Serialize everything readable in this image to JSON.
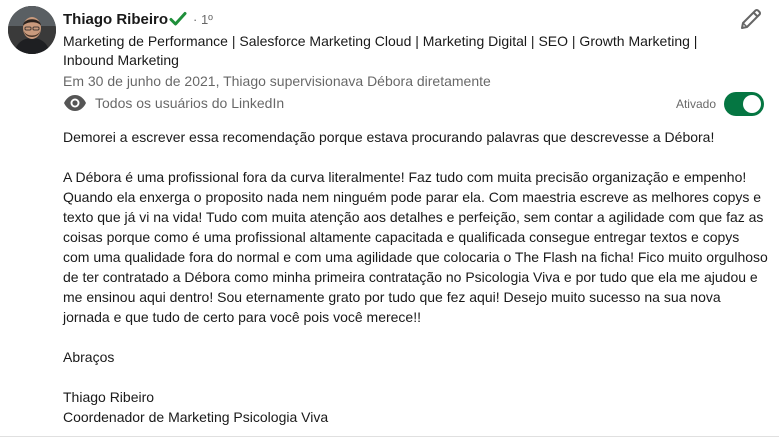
{
  "recommender": {
    "name": "Thiago Ribeiro",
    "degree": "· 1º",
    "headline": "Marketing de Performance | Salesforce Marketing Cloud | Marketing Digital | SEO | Growth Marketing | Inbound Marketing",
    "relationship": "Em 30 de junho de 2021, Thiago supervisionava Débora diretamente"
  },
  "visibility": {
    "text": "Todos os usuários do LinkedIn",
    "toggle_label": "Ativado",
    "toggle_on": true
  },
  "recommendation": {
    "intro": "Demorei a escrever essa recomendação porque estava procurando palavras que descrevesse a Débora!",
    "main": "A Débora é uma profissional fora da curva literalmente! Faz tudo com muita precisão organização e empenho! Quando ela enxerga o proposito nada nem ninguém pode parar ela. Com maestria escreve as melhores copys e texto que já vi na vida! Tudo com muita atenção aos detalhes e perfeição, sem contar a agilidade com que faz as coisas porque como é uma profissional altamente capacitada e qualificada consegue entregar textos e copys com uma qualidade fora do normal e com uma agilidade que colocaria o The Flash na ficha! Fico muito orgulhoso de ter contratado a Débora como minha primeira contratação no Psicologia Viva e por tudo que ela me ajudou e me ensinou aqui dentro! Sou eternamente grato por tudo que fez aqui! Desejo muito sucesso na sua nova jornada e que tudo de certo para você pois você merece!!",
    "closing": "Abraços",
    "signature_name": "Thiago Ribeiro",
    "signature_title": "Coordenador de Marketing Psicologia Viva"
  },
  "icons": {
    "verified": "verified-check-icon",
    "edit": "pencil-icon",
    "visibility": "eye-icon"
  },
  "colors": {
    "toggle_on": "#057642",
    "verified": "#1f8f3a",
    "text_primary": "rgba(0,0,0,0.9)",
    "text_secondary": "rgba(0,0,0,0.6)"
  }
}
